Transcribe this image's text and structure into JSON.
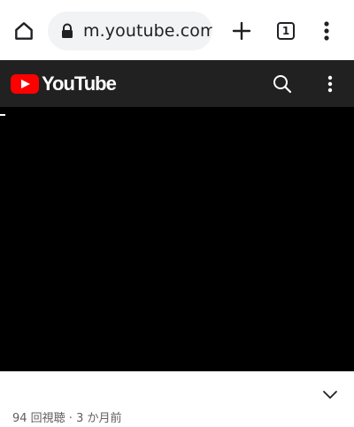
{
  "browser": {
    "url": "m.youtube.com/v",
    "tab_count": "1",
    "icons": {
      "home": "home-icon",
      "lock": "lock-icon",
      "new_tab": "plus-icon",
      "menu": "more-vert-icon"
    }
  },
  "youtube_header": {
    "logo_text": "YouTube",
    "brand_color": "#ff0000",
    "icons": {
      "search": "search-icon",
      "menu": "more-vert-icon"
    }
  },
  "video": {
    "meta_text": "94 回視聴 · 3 か月前",
    "expand_icon": "chevron-down-icon"
  }
}
